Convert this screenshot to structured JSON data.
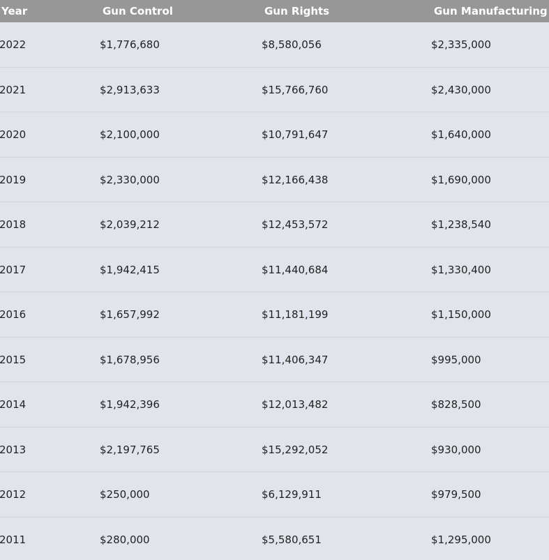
{
  "table": {
    "headers": {
      "year": "Year",
      "gun_control": "Gun Control",
      "gun_rights": "Gun Rights",
      "gun_manufacturing": "Gun Manufacturing"
    },
    "rows": [
      {
        "year": "2022",
        "gun_control": "$1,776,680",
        "gun_rights": "$8,580,056",
        "gun_manufacturing": "$2,335,000"
      },
      {
        "year": "2021",
        "gun_control": "$2,913,633",
        "gun_rights": "$15,766,760",
        "gun_manufacturing": "$2,430,000"
      },
      {
        "year": "2020",
        "gun_control": "$2,100,000",
        "gun_rights": "$10,791,647",
        "gun_manufacturing": "$1,640,000"
      },
      {
        "year": "2019",
        "gun_control": "$2,330,000",
        "gun_rights": "$12,166,438",
        "gun_manufacturing": "$1,690,000"
      },
      {
        "year": "2018",
        "gun_control": "$2,039,212",
        "gun_rights": "$12,453,572",
        "gun_manufacturing": "$1,238,540"
      },
      {
        "year": "2017",
        "gun_control": "$1,942,415",
        "gun_rights": "$11,440,684",
        "gun_manufacturing": "$1,330,400"
      },
      {
        "year": "2016",
        "gun_control": "$1,657,992",
        "gun_rights": "$11,181,199",
        "gun_manufacturing": "$1,150,000"
      },
      {
        "year": "2015",
        "gun_control": "$1,678,956",
        "gun_rights": "$11,406,347",
        "gun_manufacturing": "$995,000"
      },
      {
        "year": "2014",
        "gun_control": "$1,942,396",
        "gun_rights": "$12,013,482",
        "gun_manufacturing": "$828,500"
      },
      {
        "year": "2013",
        "gun_control": "$2,197,765",
        "gun_rights": "$15,292,052",
        "gun_manufacturing": "$930,000"
      },
      {
        "year": "2012",
        "gun_control": "$250,000",
        "gun_rights": "$6,129,911",
        "gun_manufacturing": "$979,500"
      },
      {
        "year": "2011",
        "gun_control": "$280,000",
        "gun_rights": "$5,580,651",
        "gun_manufacturing": "$1,295,000"
      }
    ]
  }
}
